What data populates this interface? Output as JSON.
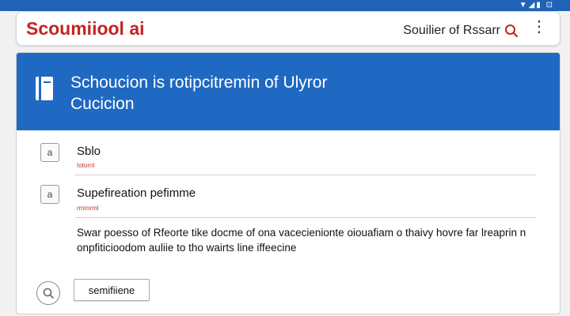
{
  "status_bar": {
    "icons": "▼◢▮ ⊡"
  },
  "app_bar": {
    "title": "Scoumiiool ai",
    "search_label": "Souilier of Rssarr"
  },
  "card": {
    "header_title_line1": "Schoucion is rotipcitremin of Ulyror",
    "header_title_line2": "Cucicion",
    "rows": [
      {
        "icon": "a",
        "title": "Sblo",
        "sub": "Iotornl"
      },
      {
        "icon": "a",
        "title": "Supefireation pefimme",
        "sub": "rmrorml"
      }
    ],
    "description": "Swar poesso of Rfeorte tike docme of ona vacecienionte oiouafiam o thaivy hovre far lreaprin n onpfiticioodom auliie to tho wairts line iffeecine",
    "footer_button": "semifiiene"
  },
  "colors": {
    "brand_red": "#c42325",
    "header_blue": "#1f69c2",
    "status_blue": "#1f62b6"
  }
}
